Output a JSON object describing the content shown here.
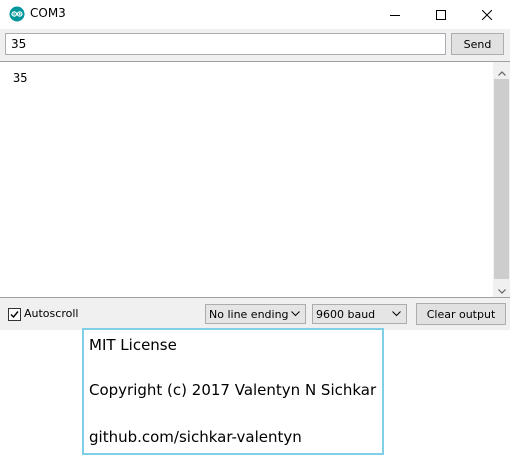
{
  "window": {
    "title": "COM3",
    "icons": {
      "app": "arduino-logo-icon",
      "minimize": "minimize-icon",
      "maximize": "maximize-icon",
      "close": "close-icon"
    },
    "accent": "#00979c"
  },
  "send_bar": {
    "input_value": "35",
    "send_label": "Send"
  },
  "output": {
    "text": "35"
  },
  "bottom_bar": {
    "autoscroll_label": "Autoscroll",
    "autoscroll_checked": true,
    "line_ending_selected": "No line ending",
    "baud_selected": "9600 baud",
    "clear_label": "Clear output"
  },
  "overlay": {
    "title": "MIT License",
    "copyright": "Copyright (c) 2017 Valentyn N Sichkar",
    "link": "github.com/sichkar-valentyn",
    "border_color": "#7fd0e6"
  }
}
